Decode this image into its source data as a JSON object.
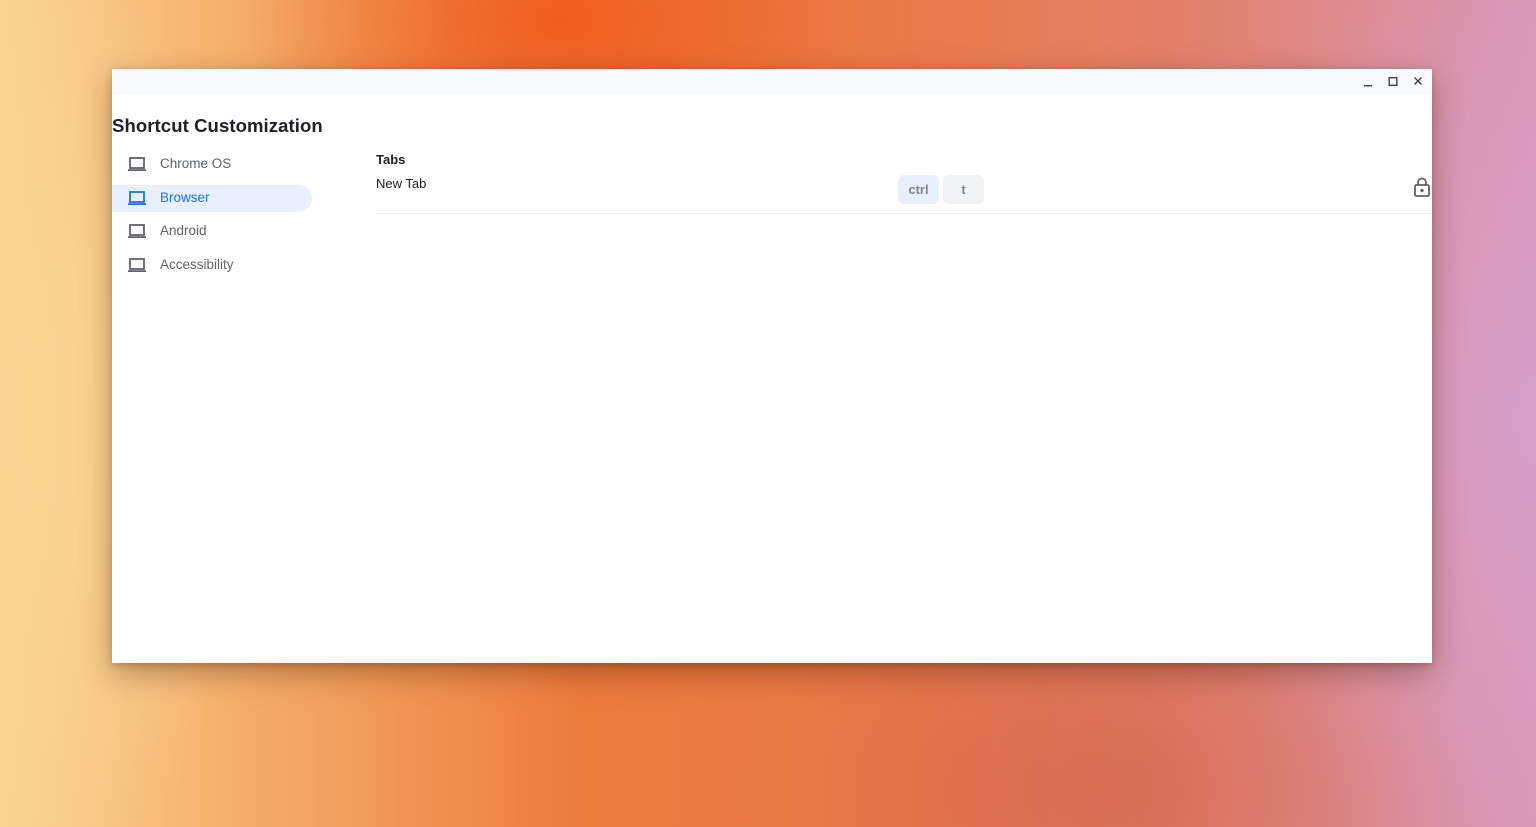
{
  "window": {
    "controls": {
      "minimize_icon": "minimize-icon",
      "maximize_icon": "maximize-icon",
      "close_icon": "close-icon"
    }
  },
  "app": {
    "title": "Shortcut Customization"
  },
  "sidebar": {
    "items": [
      {
        "label": "Chrome OS",
        "icon": "laptop-icon",
        "active": false
      },
      {
        "label": "Browser",
        "icon": "laptop-icon",
        "active": true
      },
      {
        "label": "Android",
        "icon": "laptop-icon",
        "active": false
      },
      {
        "label": "Accessibility",
        "icon": "laptop-icon",
        "active": false
      }
    ]
  },
  "main": {
    "section_title": "Tabs",
    "shortcuts": [
      {
        "description": "New Tab",
        "keys": [
          "ctrl",
          "t"
        ],
        "locked_icon": "lock-icon"
      }
    ]
  },
  "colors": {
    "accent": "#1a73e8",
    "active_nav_bg": "#e8f0fe",
    "modifier_key_bg": "#e8f0fe",
    "key_bg": "#f1f3f4",
    "icon_gray": "#5f6368"
  }
}
